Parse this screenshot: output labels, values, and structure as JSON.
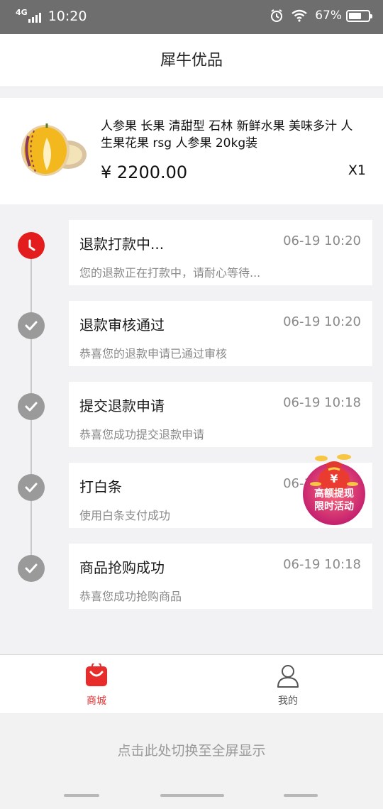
{
  "status_bar": {
    "network": "4G",
    "time": "10:20",
    "battery": "67%",
    "battery_level": 0.67,
    "icons": [
      "alarm-icon",
      "wifi-icon",
      "battery-icon",
      "signal-icon"
    ]
  },
  "header": {
    "title": "犀牛优品"
  },
  "product": {
    "name": "人参果 长果 清甜型 石林 新鲜水果 美味多汁 人生果花果 rsg 人参果 20kg装",
    "price": "¥ 2200.00",
    "quantity": "X1"
  },
  "timeline": [
    {
      "title": "退款打款中...",
      "time": "06-19 10:20",
      "desc": "您的退款正在打款中，请耐心等待...",
      "status": "active",
      "icon": "clock-icon"
    },
    {
      "title": "退款审核通过",
      "time": "06-19 10:20",
      "desc": "恭喜您的退款申请已通过审核",
      "status": "done",
      "icon": "check-icon"
    },
    {
      "title": "提交退款申请",
      "time": "06-19 10:18",
      "desc": "恭喜您成功提交退款申请",
      "status": "done",
      "icon": "check-icon"
    },
    {
      "title": "打白条",
      "time": "06-19 10:18",
      "desc": "使用白条支付成功",
      "status": "done",
      "icon": "check-icon"
    },
    {
      "title": "商品抢购成功",
      "time": "06-19 10:18",
      "desc": "恭喜您成功抢购商品",
      "status": "done",
      "icon": "check-icon"
    }
  ],
  "promo": {
    "symbol": "¥",
    "line1": "高额提现",
    "line2": "限时活动"
  },
  "tab_bar": {
    "tabs": [
      {
        "label": "商城",
        "icon": "shopping-bag-icon",
        "active": true
      },
      {
        "label": "我的",
        "icon": "person-icon",
        "active": false
      }
    ]
  },
  "fullscreen_hint": "点击此处切换至全屏显示",
  "colors": {
    "accent": "#e31d1d",
    "status_bar": "#6e6e6e",
    "muted_text": "#8a8a8a",
    "dot_done": "#9a9a9a"
  }
}
